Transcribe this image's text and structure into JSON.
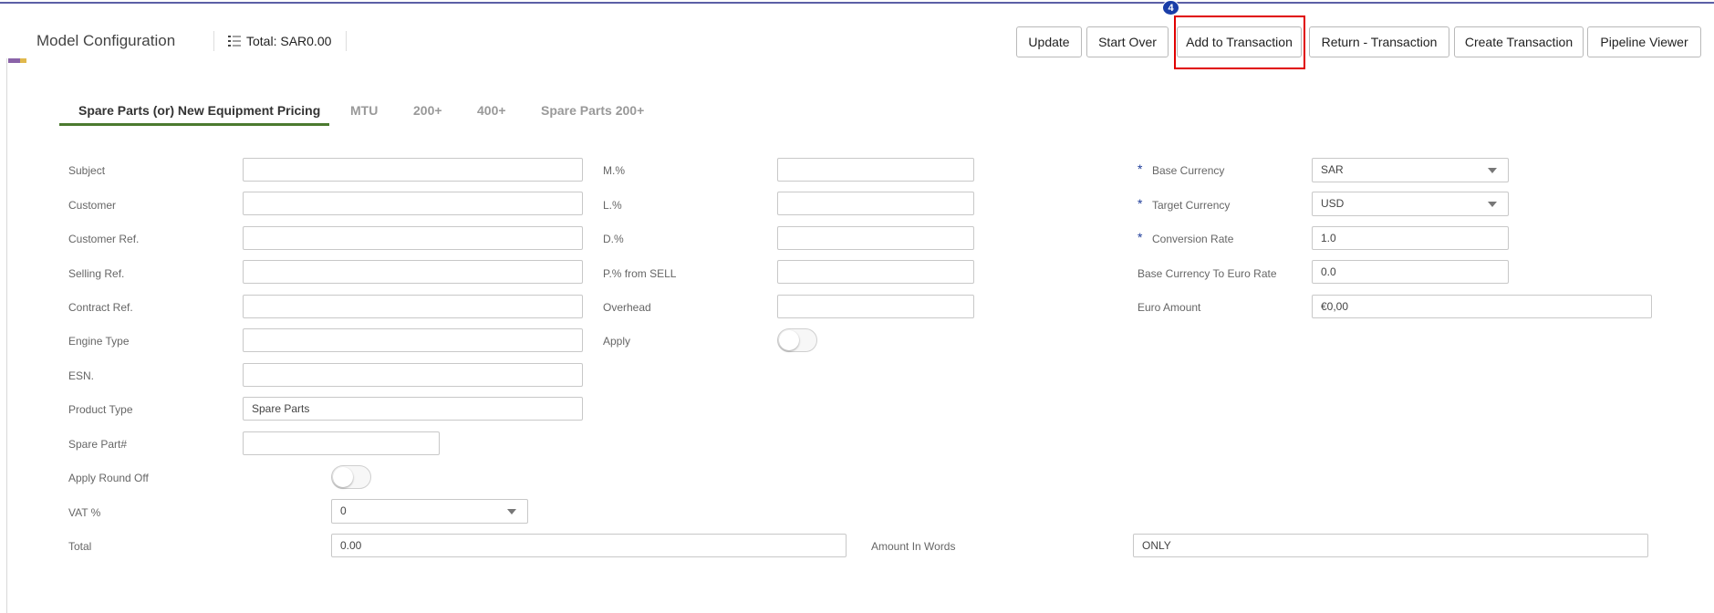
{
  "header": {
    "title": "Model Configuration",
    "total_label": "Total: SAR0.00",
    "step_badge": "4"
  },
  "toolbar": {
    "update": "Update",
    "start_over": "Start Over",
    "add_to_transaction": "Add to Transaction",
    "return_transaction": "Return - Transaction",
    "create_transaction": "Create Transaction",
    "pipeline_viewer": "Pipeline Viewer"
  },
  "tabs": [
    {
      "label": "Spare Parts (or) New Equipment Pricing",
      "active": true
    },
    {
      "label": "MTU",
      "active": false
    },
    {
      "label": "200+",
      "active": false
    },
    {
      "label": "400+",
      "active": false
    },
    {
      "label": "Spare Parts 200+",
      "active": false
    }
  ],
  "form": {
    "left": {
      "subject": {
        "label": "Subject",
        "value": ""
      },
      "customer": {
        "label": "Customer",
        "value": ""
      },
      "customer_ref": {
        "label": "Customer Ref.",
        "value": ""
      },
      "selling_ref": {
        "label": "Selling Ref.",
        "value": ""
      },
      "contract_ref": {
        "label": "Contract Ref.",
        "value": ""
      },
      "engine_type": {
        "label": "Engine Type",
        "value": ""
      },
      "esn": {
        "label": "ESN.",
        "value": ""
      },
      "product_type": {
        "label": "Product Type",
        "value": "Spare Parts"
      },
      "spare_part": {
        "label": "Spare Part#",
        "value": ""
      },
      "apply_round_off": {
        "label": "Apply Round Off",
        "on": false
      },
      "vat": {
        "label": "VAT %",
        "value": "0"
      },
      "total": {
        "label": "Total",
        "value": "0.00"
      }
    },
    "middle": {
      "m_pct": {
        "label": "M.%",
        "value": ""
      },
      "l_pct": {
        "label": "L.%",
        "value": ""
      },
      "d_pct": {
        "label": "D.%",
        "value": ""
      },
      "p_pct": {
        "label": "P.% from SELL",
        "value": ""
      },
      "overhead": {
        "label": "Overhead",
        "value": ""
      },
      "apply": {
        "label": "Apply",
        "on": false
      },
      "amount_in_words": {
        "label": "Amount In Words",
        "value": "ONLY"
      }
    },
    "right": {
      "base_currency": {
        "label": "Base Currency",
        "value": "SAR",
        "required": "*"
      },
      "target_currency": {
        "label": "Target Currency",
        "value": "USD",
        "required": "*"
      },
      "conversion_rate": {
        "label": "Conversion Rate",
        "value": "1.0",
        "required": "*"
      },
      "base_to_euro": {
        "label": "Base Currency To Euro Rate",
        "value": "0.0"
      },
      "euro_amount": {
        "label": "Euro Amount",
        "value": "€0,00"
      }
    }
  },
  "colors": {
    "accent_underline": "#4b7a2f",
    "highlight_box": "#e00000",
    "badge": "#1a3ea8",
    "required_star": "#1f3d99"
  },
  "icons": [
    "list-icon",
    "caret-down-icon"
  ]
}
